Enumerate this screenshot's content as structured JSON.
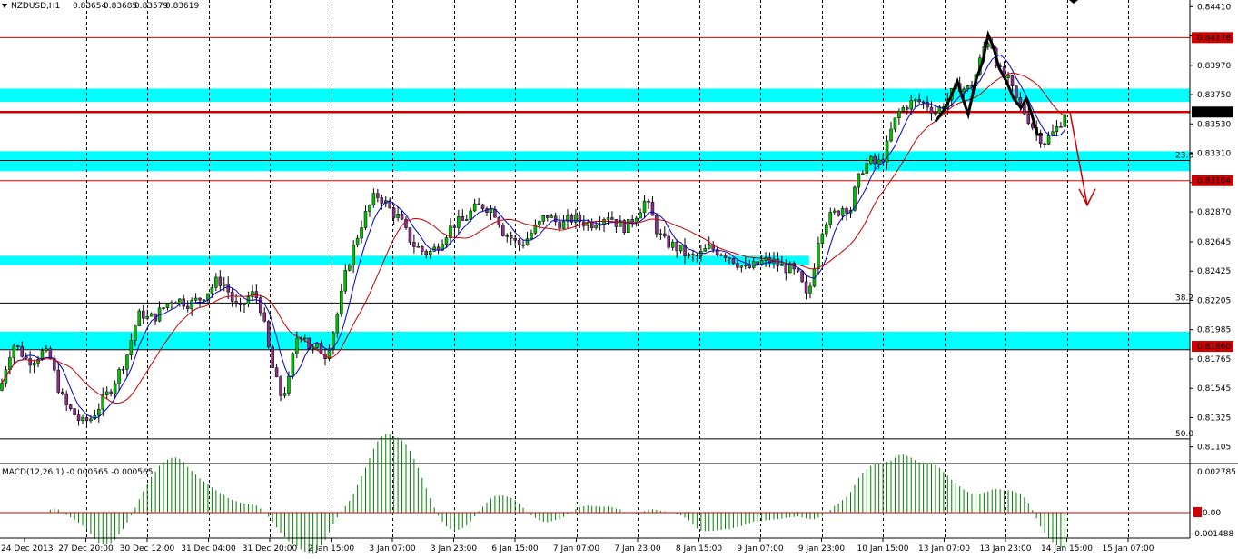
{
  "chart_data": {
    "type": "candlestick",
    "symbol_header": "NZDUSD,H1",
    "ohlc_readout": [
      "0.83654",
      "0.83685",
      "0.83579",
      "0.83619"
    ],
    "price_axis": {
      "min": 0.8098,
      "max": 0.8446,
      "ticks": [
        "0.84410",
        "0.84190",
        "0.83970",
        "0.83750",
        "0.83530",
        "0.83310",
        "0.83090",
        "0.82870",
        "0.82645",
        "0.82425",
        "0.82205",
        "0.81985",
        "0.81765",
        "0.81545",
        "0.81325",
        "0.81105"
      ],
      "current_price_label": "0.83619",
      "marker_labels": [
        {
          "text": "0.84178",
          "value": 0.84178,
          "color": "#d00000"
        },
        {
          "text": "0.83104",
          "value": 0.83104,
          "color": "#d00000"
        },
        {
          "text": "0.81860",
          "value": 0.8186,
          "color": "#d00000"
        }
      ]
    },
    "time_axis": {
      "labels": [
        "24 Dec 2013",
        "27 Dec 20:00",
        "30 Dec 12:00",
        "31 Dec 04:00",
        "31 Dec 20:00",
        "2 Jan 15:00",
        "3 Jan 07:00",
        "3 Jan 23:00",
        "6 Jan 15:00",
        "7 Jan 07:00",
        "7 Jan 23:00",
        "8 Jan 15:00",
        "9 Jan 07:00",
        "9 Jan 23:00",
        "10 Jan 15:00",
        "13 Jan 07:00",
        "13 Jan 23:00",
        "14 Jan 15:00",
        "15 Jan 07:00"
      ]
    },
    "horizontal_lines": [
      {
        "value": 0.84178,
        "color": "#d00000",
        "width": 1
      },
      {
        "value": 0.83619,
        "color": "#d00000",
        "width": 2.5
      },
      {
        "value": 0.83104,
        "color": "#d00000",
        "width": 1
      },
      {
        "value": 0.82185,
        "color": "#000000",
        "width": 1,
        "label": "38.2"
      },
      {
        "value": 0.83256,
        "color": "#000000",
        "width": 1,
        "label": "23.6"
      },
      {
        "value": 0.81165,
        "color": "#000000",
        "width": 1,
        "label": "50.0"
      },
      {
        "value": 0.81835,
        "color": "#000000",
        "width": 1
      }
    ],
    "zones": [
      {
        "low": 0.83695,
        "high": 0.83795,
        "start_fraction": 0,
        "end_fraction": 1,
        "color": "#00ffff"
      },
      {
        "low": 0.83175,
        "high": 0.83325,
        "start_fraction": 0,
        "end_fraction": 1,
        "color": "#00ffff"
      },
      {
        "low": 0.8247,
        "high": 0.8254,
        "start_fraction": 0,
        "end_fraction": 0.68,
        "color": "#00ffff"
      },
      {
        "low": 0.8184,
        "high": 0.8197,
        "start_fraction": 0,
        "end_fraction": 1,
        "color": "#00ffff"
      }
    ],
    "price_path": [
      [
        0,
        0.8153
      ],
      [
        8,
        0.8175
      ],
      [
        14,
        0.8188
      ],
      [
        22,
        0.8183
      ],
      [
        30,
        0.8175
      ],
      [
        38,
        0.8177
      ],
      [
        48,
        0.8182
      ],
      [
        56,
        0.8176
      ],
      [
        62,
        0.816
      ],
      [
        68,
        0.8148
      ],
      [
        74,
        0.814
      ],
      [
        82,
        0.8135
      ],
      [
        90,
        0.8128
      ],
      [
        100,
        0.8132
      ],
      [
        110,
        0.8142
      ],
      [
        120,
        0.8152
      ],
      [
        130,
        0.8165
      ],
      [
        140,
        0.818
      ],
      [
        148,
        0.82
      ],
      [
        155,
        0.8212
      ],
      [
        162,
        0.8207
      ],
      [
        170,
        0.8208
      ],
      [
        180,
        0.8215
      ],
      [
        190,
        0.8222
      ],
      [
        200,
        0.822
      ],
      [
        210,
        0.8218
      ],
      [
        220,
        0.8222
      ],
      [
        230,
        0.8228
      ],
      [
        240,
        0.8236
      ],
      [
        248,
        0.8232
      ],
      [
        256,
        0.822
      ],
      [
        264,
        0.8212
      ],
      [
        272,
        0.8222
      ],
      [
        280,
        0.8226
      ],
      [
        286,
        0.8218
      ],
      [
        292,
        0.8198
      ],
      [
        298,
        0.8175
      ],
      [
        304,
        0.816
      ],
      [
        310,
        0.8148
      ],
      [
        318,
        0.816
      ],
      [
        326,
        0.8192
      ],
      [
        334,
        0.8198
      ],
      [
        342,
        0.8182
      ],
      [
        350,
        0.8185
      ],
      [
        358,
        0.818
      ],
      [
        366,
        0.8195
      ],
      [
        374,
        0.8218
      ],
      [
        382,
        0.8245
      ],
      [
        390,
        0.8262
      ],
      [
        398,
        0.8278
      ],
      [
        406,
        0.829
      ],
      [
        414,
        0.83
      ],
      [
        422,
        0.8296
      ],
      [
        430,
        0.8288
      ],
      [
        440,
        0.8282
      ],
      [
        448,
        0.827
      ],
      [
        456,
        0.8262
      ],
      [
        464,
        0.8258
      ],
      [
        472,
        0.8256
      ],
      [
        480,
        0.826
      ],
      [
        490,
        0.827
      ],
      [
        500,
        0.8278
      ],
      [
        510,
        0.828
      ],
      [
        520,
        0.8288
      ],
      [
        530,
        0.8292
      ],
      [
        538,
        0.829
      ],
      [
        546,
        0.8286
      ],
      [
        554,
        0.8272
      ],
      [
        562,
        0.8268
      ],
      [
        570,
        0.8262
      ],
      [
        578,
        0.8265
      ],
      [
        586,
        0.8272
      ],
      [
        594,
        0.8278
      ],
      [
        602,
        0.8285
      ],
      [
        610,
        0.828
      ],
      [
        620,
        0.8278
      ],
      [
        630,
        0.8282
      ],
      [
        640,
        0.828
      ],
      [
        650,
        0.8278
      ],
      [
        660,
        0.8282
      ],
      [
        670,
        0.8285
      ],
      [
        680,
        0.8278
      ],
      [
        690,
        0.8275
      ],
      [
        700,
        0.8285
      ],
      [
        710,
        0.8295
      ],
      [
        716,
        0.8288
      ],
      [
        722,
        0.8275
      ],
      [
        730,
        0.8265
      ],
      [
        740,
        0.8262
      ],
      [
        750,
        0.8258
      ],
      [
        760,
        0.8252
      ],
      [
        770,
        0.8254
      ],
      [
        780,
        0.826
      ],
      [
        790,
        0.8258
      ],
      [
        800,
        0.8255
      ],
      [
        810,
        0.825
      ],
      [
        820,
        0.8244
      ],
      [
        830,
        0.8246
      ],
      [
        840,
        0.825
      ],
      [
        850,
        0.825
      ],
      [
        860,
        0.8246
      ],
      [
        870,
        0.8244
      ],
      [
        880,
        0.8238
      ],
      [
        888,
        0.8222
      ],
      [
        894,
        0.8236
      ],
      [
        900,
        0.8265
      ],
      [
        908,
        0.828
      ],
      [
        916,
        0.8284
      ],
      [
        924,
        0.8288
      ],
      [
        930,
        0.8292
      ],
      [
        936,
        0.8288
      ],
      [
        942,
        0.8305
      ],
      [
        950,
        0.832
      ],
      [
        958,
        0.8325
      ],
      [
        966,
        0.8322
      ],
      [
        974,
        0.833
      ],
      [
        982,
        0.835
      ],
      [
        990,
        0.8362
      ],
      [
        1000,
        0.8368
      ],
      [
        1010,
        0.837
      ],
      [
        1020,
        0.8368
      ],
      [
        1030,
        0.8362
      ],
      [
        1040,
        0.8368
      ],
      [
        1048,
        0.8376
      ],
      [
        1056,
        0.8382
      ],
      [
        1064,
        0.8378
      ],
      [
        1072,
        0.8385
      ],
      [
        1078,
        0.8398
      ],
      [
        1084,
        0.8412
      ],
      [
        1090,
        0.8418
      ],
      [
        1096,
        0.8402
      ],
      [
        1102,
        0.839
      ],
      [
        1110,
        0.8385
      ],
      [
        1118,
        0.8372
      ],
      [
        1126,
        0.8364
      ],
      [
        1134,
        0.8355
      ],
      [
        1142,
        0.8345
      ],
      [
        1150,
        0.834
      ],
      [
        1158,
        0.8345
      ],
      [
        1166,
        0.8352
      ],
      [
        1172,
        0.8362
      ],
      [
        1176,
        0.8365
      ]
    ],
    "forecast_arrow": {
      "from_value": 0.83619,
      "to_value": 0.8292,
      "color": "#d00000"
    },
    "macd": {
      "label": "MACD(12,26,1) -0.000565 -0.000565",
      "axis_ticks": [
        "0.002785",
        "0.00",
        "-0.001488"
      ],
      "zero_label": "0.00",
      "range": [
        -0.0015,
        0.0029
      ]
    }
  }
}
